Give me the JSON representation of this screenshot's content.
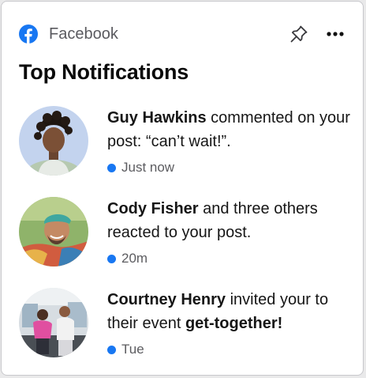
{
  "widget": {
    "app_name": "Facebook",
    "title": "Top Notifications",
    "accent_color": "#1877f2",
    "icons": {
      "app": "facebook-logo-icon",
      "pin": "pin-icon",
      "more": "more-options-icon"
    }
  },
  "notifications": [
    {
      "name": "Guy Hawkins",
      "text_after_name": " commented on your post: “can’t wait!”.",
      "bold_suffix": "",
      "time": "Just now",
      "unread": true
    },
    {
      "name": "Cody Fisher",
      "text_after_name": " and three others reacted to your post.",
      "bold_suffix": "",
      "time": "20m",
      "unread": true
    },
    {
      "name": "Courtney Henry",
      "text_after_name": " invited your to their event ",
      "bold_suffix": "get-together!",
      "time": "Tue",
      "unread": true
    }
  ]
}
